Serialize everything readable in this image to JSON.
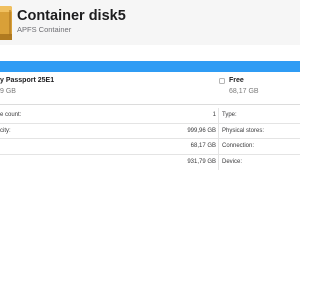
{
  "header": {
    "title": "Container disk5",
    "subtitle": "APFS Container"
  },
  "colors": {
    "used_bar": "#2f9cf4",
    "header_bg": "#f6f6f6"
  },
  "usage": {
    "used_fraction": 1.0,
    "used_name": "y Passport 25E1",
    "used_size": "9 GB",
    "free_name": "Free",
    "free_size": "68,17 GB"
  },
  "info": {
    "rows": [
      {
        "left_label": "e count:",
        "left_value": "1",
        "right_label": "Type:"
      },
      {
        "left_label": "city:",
        "left_value": "999,96 GB",
        "right_label": "Physical stores:"
      },
      {
        "left_label": "",
        "left_value": "68,17 GB",
        "right_label": "Connection:"
      },
      {
        "left_label": "",
        "left_value": "931,79 GB",
        "right_label": "Device:"
      }
    ]
  }
}
